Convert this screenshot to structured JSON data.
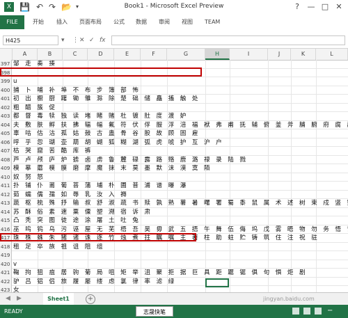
{
  "window": {
    "title": "Book1 - Microsoft Excel Preview"
  },
  "ribbon": {
    "file_tab": "FILE",
    "tabs": [
      "开始",
      "插入",
      "页面布局",
      "公式",
      "数据",
      "审阅",
      "视图",
      "TEAM"
    ]
  },
  "formula_bar": {
    "name_box": "H425",
    "fx_label": "fx"
  },
  "columns": {
    "headers": [
      "A",
      "B",
      "C",
      "D",
      "E",
      "F",
      "G",
      "H",
      "I",
      "J",
      "K",
      "L"
    ],
    "selected": "H"
  },
  "rows": [
    {
      "n": "397",
      "text": "邹 走 奏 揍"
    },
    {
      "n": "398",
      "text": ""
    },
    {
      "n": "399",
      "text": "u"
    },
    {
      "n": "400",
      "text": "捕 卜 哺 补 埠 不 布 步 簿 部 怖"
    },
    {
      "n": "401",
      "text": "初 出 橱 厨 躇 锄 雏 滁 除 楚 础 储 矗 搐 触 处"
    },
    {
      "n": "402",
      "text": "粗 醋 簇 促"
    },
    {
      "n": "403",
      "text": "都 督 毒 犊 独 读 堵 睹 赌 杜 镀 肚 度 渡 妒"
    },
    {
      "n": "404",
      "text": "夫 敷 肤 孵 扶 拂 辐 幅 氟 符 伏 俘 服 浮 涪 福 袱 弗 甫 抚 辅 俯 釜 斧 脯 腑 府 腐 赴 副 覆 赋 复"
    },
    {
      "n": "405",
      "text": "辜 咕 估 沽 孤 姑 鼓 古 蛊 骨 谷 股 故 顾 固 雇"
    },
    {
      "n": "406",
      "text": "呼 乎 忽 瑚 壶 葫 胡 蝴 狐 糊 湖 弧 虎 唬 护 互 沪 户"
    },
    {
      "n": "407",
      "text": "枯 哭 窟 苦 酷 库 裤"
    },
    {
      "n": "408",
      "text": "芦 卢 颅 庐 炉 掳 卤 虏 鲁 麓 碌 露 路 赂 鹿 潞 禄 录 陆 戮"
    },
    {
      "n": "409",
      "text": "模 摹 蘑 模 膜 磨 摩 魔 抹 末 莫 墨 默 沫 漠 寞 陌"
    },
    {
      "n": "410",
      "text": "奴 努 怒"
    },
    {
      "n": "411",
      "text": "扑 铺 仆 莆 葡 菩 蒲 埔 朴 圃 普 浦 谱 曝 瀑"
    },
    {
      "n": "412",
      "text": "茹 蠕 儒 孺 如 辱 乳 汝 入 褥"
    },
    {
      "n": "413",
      "text": "蔬 枢 梳 殊 抒 输 叔 舒 淑 疏 书 赎 孰 熟 薯 暑 曙 署 蜀 黍 鼠 属 术 述 树 束 戍 竖 墅 庶 数 漱 恕"
    },
    {
      "n": "414",
      "text": "苏 酥 俗 素 速 粟 僳 塑 溯 宿 诉 肃"
    },
    {
      "n": "415",
      "text": "凸 秃 突 图 徒 途 涂 屠 土 吐 兔"
    },
    {
      "n": "416",
      "text": "巫 呜 钨 乌 污 诬 屋 无 芜 梧 吾 吴 毋 武 五 捂 午 舞 伍 侮 坞 戊 雾 晤 物 勿 务 悟 误"
    },
    {
      "n": "417",
      "text": "珠 株 蛛 朱 猪 诸 诛 逐 竹 烛 煮 拄 瞩 嘱 主 著 柱 助 蛀 贮 铸 筑 住 注 祝 驻"
    },
    {
      "n": "418",
      "text": "租 足 卒 族 祖 诅 阻 组"
    },
    {
      "n": "419",
      "text": ""
    },
    {
      "n": "420",
      "text": "v"
    },
    {
      "n": "421",
      "text": "鞠 拘 狙 疽 居 驹 菊 局 咀 矩 举 沮 聚 拒 据 巨 具 距 踞 锯 俱 句 惧 炬 剧"
    },
    {
      "n": "422",
      "text": "驴 吕 铝 侣 旅 履 屡 缕 虑 氯 律 率 滤 绿"
    },
    {
      "n": "423",
      "text": "女"
    },
    {
      "n": "424",
      "text": "趋 区 蛆 曲 躯 屈 驱 渠 取 娶 龋 趣 去"
    },
    {
      "n": "425",
      "text": "墟 戌 需 虚 嘘 须 徐 许 蓄 酗 叙 旭 序 畜 恤 絮 婿 绪 续 迂 淤 于 盂 榆 虞 愚 舆 余 俞 逾 鱼 愉 渝"
    }
  ],
  "sheet_tabs": {
    "active": "Sheet1",
    "add_label": "+"
  },
  "status_bar": {
    "ready": "READY",
    "ime": "志晟快笔"
  },
  "watermark": "jingyan.baidu.com"
}
